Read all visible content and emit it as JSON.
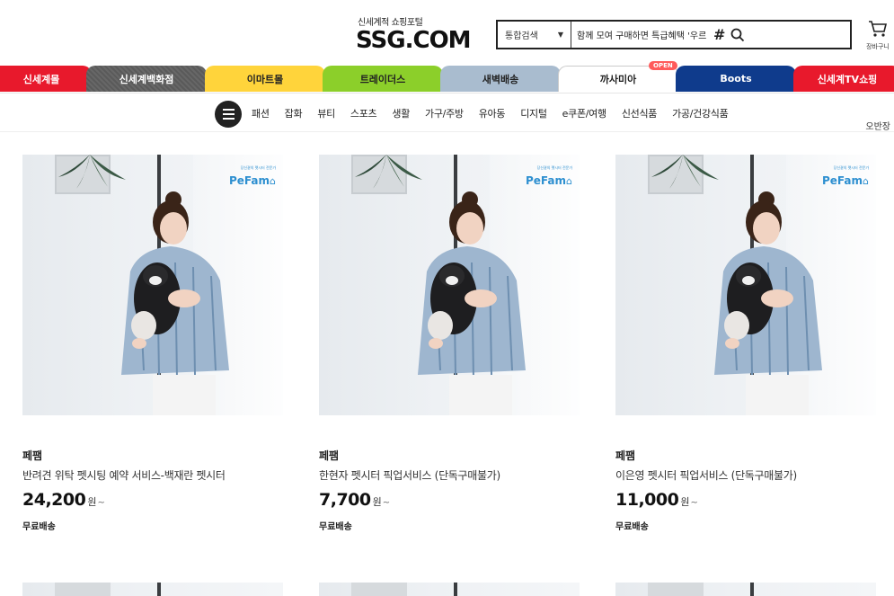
{
  "header": {
    "logo_subtitle": "신세계적 쇼핑포털",
    "logo_text": "SSG.COM",
    "search_scope": "통합검색",
    "search_value": "함께 모여 구매하면 특급혜택 '우르르'",
    "hash_symbol": "#",
    "cart_label": "장바구니"
  },
  "malls": [
    {
      "label": "신세계몰",
      "bg": "#e8192c",
      "color": "#ffffff"
    },
    {
      "label": "신세계백화점",
      "bg": "#5a5a5a",
      "color": "#ffffff"
    },
    {
      "label": "이마트몰",
      "bg": "#ffd43b",
      "color": "#222222"
    },
    {
      "label": "트레이더스",
      "bg": "#8ccf2a",
      "color": "#222222"
    },
    {
      "label": "새벽배송",
      "bg": "#a9bccf",
      "color": "#222222"
    },
    {
      "label": "까사미아",
      "bg": "#ffffff",
      "color": "#222222"
    },
    {
      "label": "Boots",
      "bg": "#0f3b8c",
      "color": "#ffffff"
    },
    {
      "label": "신세계TV쇼핑",
      "bg": "#e8192c",
      "color": "#ffffff"
    }
  ],
  "open_badge": "OPEN",
  "categories": [
    "패션",
    "잡화",
    "뷰티",
    "스포츠",
    "생활",
    "가구/주방",
    "유아동",
    "디지털",
    "e쿠폰/여행",
    "신선식품",
    "가공/건강식품"
  ],
  "store_link": "오반장",
  "pefam": {
    "tagline": "당신곁의 펫시터 전문가",
    "name": "PeFam"
  },
  "products": [
    {
      "brand": "페팸",
      "title": "반려견 위탁 펫시팅 예약 서비스-백재란 펫시터",
      "price": "24,200",
      "unit": "원",
      "suffix": "~",
      "shipping": "무료배송"
    },
    {
      "brand": "페팸",
      "title": "한현자 펫시터 픽업서비스 (단독구매불가)",
      "price": "7,700",
      "unit": "원",
      "suffix": "~",
      "shipping": "무료배송"
    },
    {
      "brand": "페팸",
      "title": "이은영 펫시터 픽업서비스 (단독구매불가)",
      "price": "11,000",
      "unit": "원",
      "suffix": "~",
      "shipping": "무료배송"
    }
  ]
}
